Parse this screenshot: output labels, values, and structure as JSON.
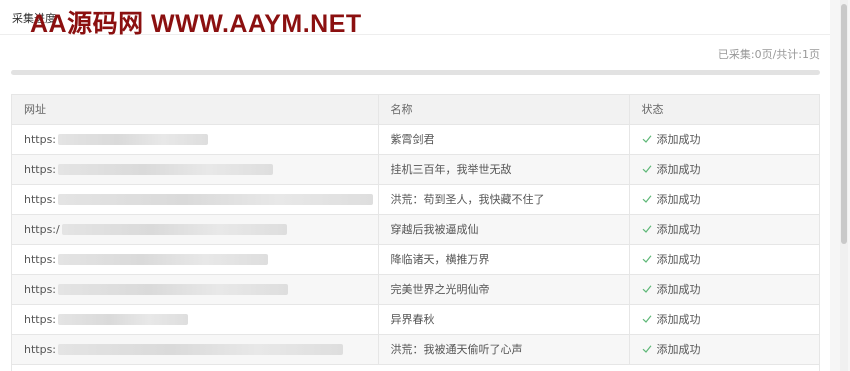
{
  "watermark": "AA源码网  WWW.AAYM.NET",
  "panel": {
    "title": "采集进度"
  },
  "progress": {
    "text": "已采集:0页/共计:1页",
    "fraction": 0
  },
  "table": {
    "headers": [
      "网址",
      "名称",
      "状态"
    ],
    "rows": [
      {
        "url": "https:",
        "name": "紫霄剑君",
        "status": "添加成功"
      },
      {
        "url": "https:",
        "name": "挂机三百年，我举世无敌",
        "status": "添加成功"
      },
      {
        "url": "https:",
        "name": "洪荒：苟到圣人，我快藏不住了",
        "status": "添加成功"
      },
      {
        "url": "https:/",
        "name": "穿越后我被逼成仙",
        "status": "添加成功"
      },
      {
        "url": "https:",
        "name": "降临诸天，横推万界",
        "status": "添加成功"
      },
      {
        "url": "https:",
        "name": "完美世界之光明仙帝",
        "status": "添加成功"
      },
      {
        "url": "https:",
        "name": "异界春秋",
        "status": "添加成功"
      },
      {
        "url": "https:",
        "name": "洪荒：我被通天偷听了心声",
        "status": "添加成功"
      }
    ]
  },
  "colors": {
    "success": "#5fb878",
    "watermark": "#8b1010"
  },
  "icons": {
    "status": "check-icon"
  }
}
